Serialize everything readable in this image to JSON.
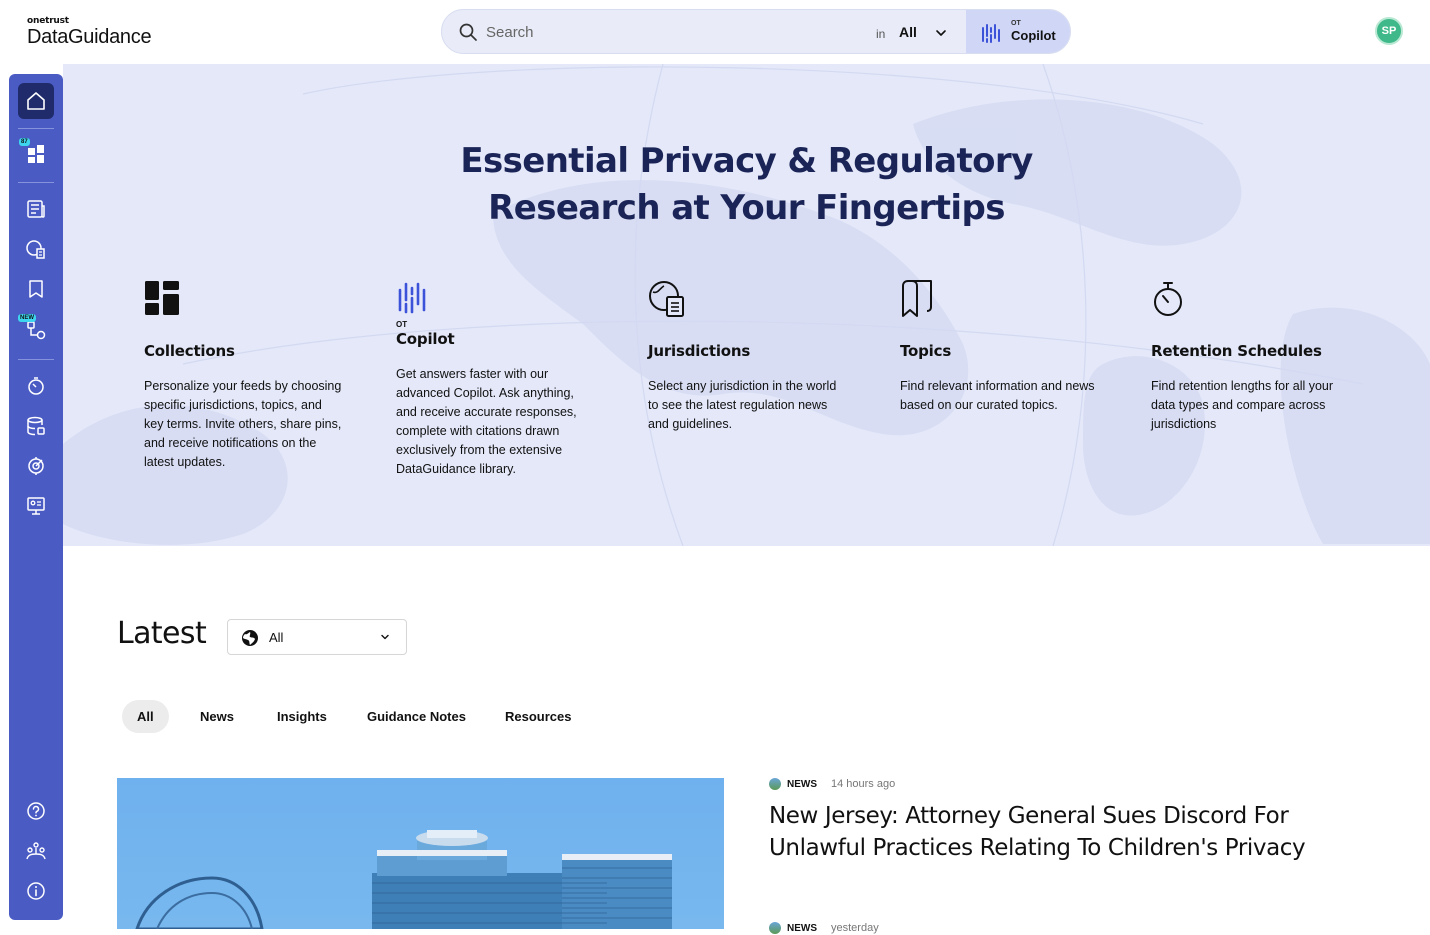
{
  "header": {
    "brand_top": "onetrust",
    "brand_main": "DataGuidance",
    "search": {
      "placeholder": "Search",
      "scope_prefix": "in",
      "scope_value": "All"
    },
    "copilot": {
      "prefix": "OT",
      "label": "Copilot"
    },
    "user_initials": "SP"
  },
  "sidebar": {
    "collections_badge": "87",
    "new_badge": "NEW"
  },
  "hero": {
    "title_line1": "Essential Privacy & Regulatory",
    "title_line2": "Research at Your Fingertips",
    "features": [
      {
        "title": "Collections",
        "description": "Personalize your feeds by choosing specific jurisdictions, topics, and key terms. Invite others, share pins, and receive notifications on the latest updates.",
        "icon": "collections-icon"
      },
      {
        "prefix": "OT",
        "title": "Copilot",
        "description": "Get answers faster with our advanced Copilot. Ask anything, and receive accurate responses, complete with citations drawn exclusively from the extensive DataGuidance library.",
        "icon": "copilot-icon"
      },
      {
        "title": "Jurisdictions",
        "description": "Select any jurisdiction in the world to see the latest regulation news and guidelines.",
        "icon": "globe-document-icon"
      },
      {
        "title": "Topics",
        "description": "Find relevant information and news based on our curated topics.",
        "icon": "bookmark-icon"
      },
      {
        "title": "Retention Schedules",
        "description": "Find retention lengths for all your data types and compare across jurisdictions",
        "icon": "stopwatch-icon"
      }
    ]
  },
  "latest": {
    "heading": "Latest",
    "region_filter": "All",
    "tabs": [
      "All",
      "News",
      "Insights",
      "Guidance Notes",
      "Resources"
    ],
    "articles": [
      {
        "type": "NEWS",
        "time": "14 hours ago",
        "title": "New Jersey: Attorney General Sues Discord For Unlawful Practices Relating To Children's Privacy"
      },
      {
        "type": "NEWS",
        "time": "yesterday"
      }
    ]
  }
}
